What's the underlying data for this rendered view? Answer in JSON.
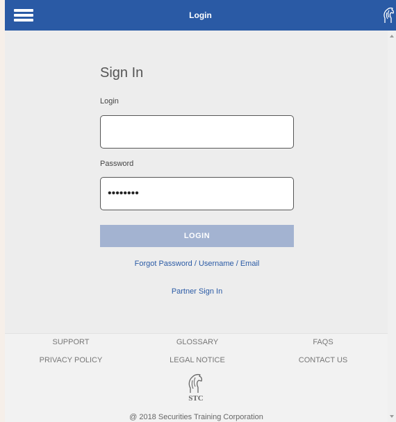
{
  "header": {
    "title": "Login",
    "menu_icon": "hamburger-menu-icon",
    "logo_icon": "horse-logo-icon",
    "background_color": "#2a5aa5"
  },
  "form": {
    "heading": "Sign In",
    "login_label": "Login",
    "login_value": "",
    "password_label": "Password",
    "password_value": "••••••••",
    "submit_label": "LOGIN",
    "forgot_link": "Forgot Password / Username / Email",
    "partner_link": "Partner Sign In"
  },
  "footer": {
    "links_row1": [
      "SUPPORT",
      "GLOSSARY",
      "FAQS"
    ],
    "links_row2": [
      "PRIVACY POLICY",
      "LEGAL NOTICE",
      "CONTACT US"
    ],
    "logo_text": "STC",
    "copyright": "@ 2018 Securities Training Corporation"
  }
}
